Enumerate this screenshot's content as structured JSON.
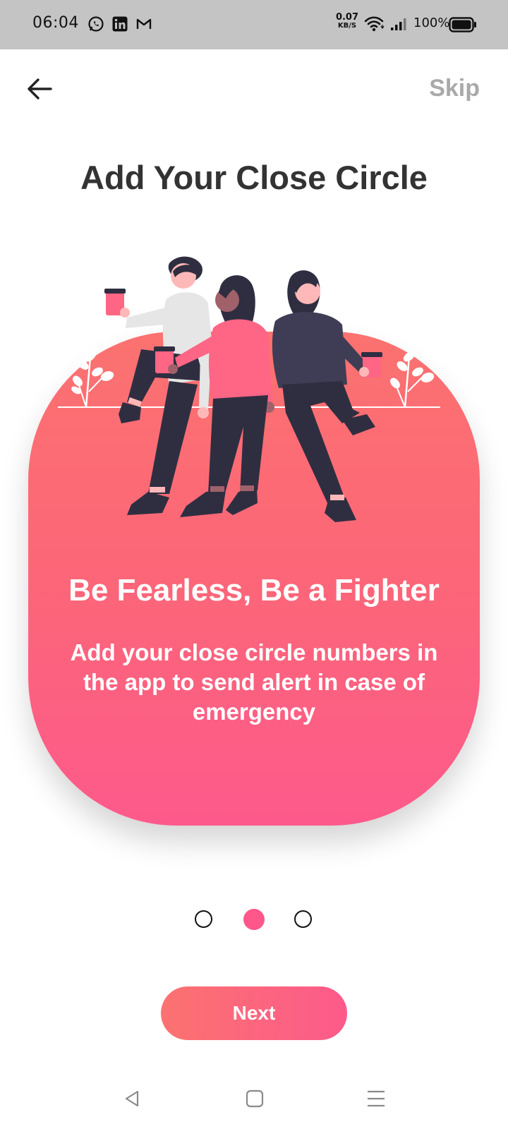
{
  "status_bar": {
    "time": "06:04",
    "notification_icons": [
      "whatsapp-icon",
      "linkedin-icon",
      "gmail-icon"
    ],
    "net_speed_value": "0.07",
    "net_speed_unit": "KB/S",
    "battery": "100%"
  },
  "header": {
    "back_icon": "arrow-left-icon",
    "skip_label": "Skip"
  },
  "title": "Add Your Close Circle",
  "card": {
    "headline": "Be Fearless, Be a Fighter",
    "body": "Add your close circle numbers in the app to send alert in case of emergency"
  },
  "pagination": {
    "total": 3,
    "active_index": 1
  },
  "next_label": "Next",
  "nav_bar": [
    "back-triangle-icon",
    "home-square-icon",
    "menu-lines-icon"
  ],
  "colors": {
    "accent_pink": "#fd5a8b",
    "accent_coral": "#fb7270",
    "title_text": "#333333",
    "skip_text": "#a9a9a9",
    "status_bar_bg": "#c4c4c4"
  }
}
